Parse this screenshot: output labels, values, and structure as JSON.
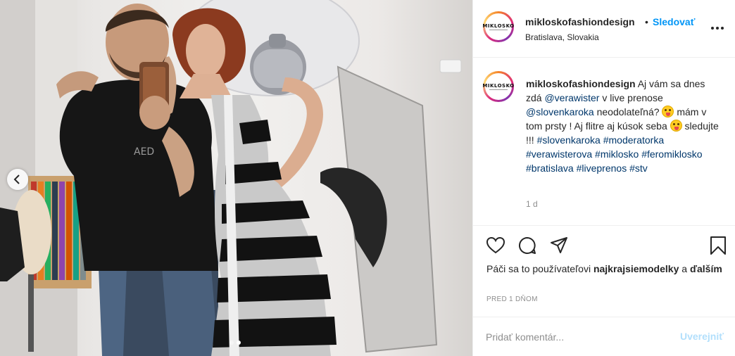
{
  "post": {
    "username": "mikloskofashiondesign",
    "avatar_brand": "MIKLOSKO",
    "bullet": "•",
    "follow_label": "Sledovať",
    "location": "Bratislava, Slovakia",
    "caption_parts": {
      "t1": "Aj vám sa dnes zdá ",
      "m1": "@verawister",
      "t2": " v live prenose ",
      "m2": "@slovenkaroka",
      "t3": " neodolateľná? ",
      "t4": " mám v tom prsty ! Aj flitre aj kúsok seba ",
      "t5": " sledujte !!! ",
      "h1": "#slovenkaroka",
      "h2": "#moderatorka",
      "h3": "#verawisterova",
      "h4": "#miklosko",
      "h5": "#feromiklosko",
      "h6": "#bratislava",
      "h7": "#liveprenos",
      "h8": "#stv"
    },
    "time_ago": "1 d",
    "likes_prefix": "Páči sa to používateľovi ",
    "likes_user": "najkrajsiemodelky",
    "likes_middle": " a ",
    "likes_others": "ďalším",
    "posted_ago": "PRED 1 DŇOM",
    "comment_placeholder": "Pridať komentár...",
    "publish_label": "Uverejniť"
  },
  "carousel": {
    "slide_count": 2,
    "active_slide": 2
  },
  "icons": {
    "like": "heart-icon",
    "comment": "speech-bubble-icon",
    "share": "paper-plane-icon",
    "save": "bookmark-icon",
    "more": "ellipsis-icon",
    "prev": "chevron-left-icon"
  },
  "colors": {
    "link": "#00376b",
    "follow": "#0095f6",
    "publish_disabled": "#b2dffc",
    "muted": "#8e8e8e"
  }
}
